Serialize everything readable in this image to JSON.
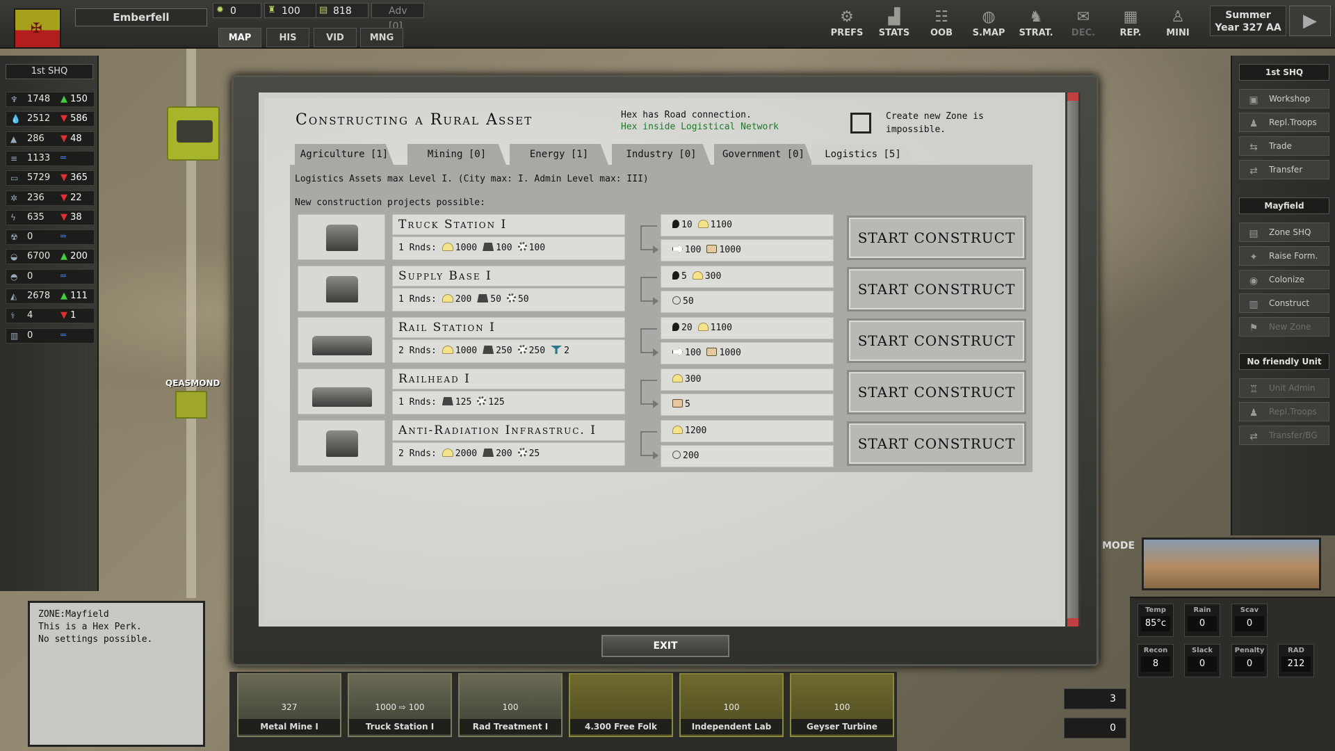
{
  "header": {
    "faction_name": "Emberfell",
    "resources": [
      {
        "icon": "sun-icon",
        "value": "0"
      },
      {
        "icon": "troops-icon",
        "value": "100"
      },
      {
        "icon": "money-icon",
        "value": "818"
      },
      {
        "icon": "adv-icon",
        "value": "Adv [0]"
      }
    ],
    "nav_tabs": [
      "MAP",
      "HIS",
      "VID",
      "MNG"
    ],
    "buttons": [
      {
        "label": "PREFS",
        "icon": "gear-icon"
      },
      {
        "label": "STATS",
        "icon": "chart-icon"
      },
      {
        "label": "OOB",
        "icon": "hierarchy-icon"
      },
      {
        "label": "S.MAP",
        "icon": "globe-icon"
      },
      {
        "label": "STRAT.",
        "icon": "strategy-icon"
      },
      {
        "label": "DEC.",
        "icon": "mail-icon"
      },
      {
        "label": "REP.",
        "icon": "report-icon"
      },
      {
        "label": "MINI",
        "icon": "person-icon"
      }
    ],
    "season": "Summer",
    "year": "Year 327 AA"
  },
  "left_panel": {
    "title": "1st SHQ",
    "stats": [
      {
        "icon": "food-icon",
        "value": "1748",
        "delta": "150",
        "trend": "up"
      },
      {
        "icon": "water-icon",
        "value": "2512",
        "delta": "586",
        "trend": "down"
      },
      {
        "icon": "oil-icon",
        "value": "286",
        "delta": "48",
        "trend": "down"
      },
      {
        "icon": "fuel-icon",
        "value": "1133",
        "delta": "",
        "trend": "eq"
      },
      {
        "icon": "metal-icon",
        "value": "5729",
        "delta": "365",
        "trend": "down"
      },
      {
        "icon": "parts-icon",
        "value": "236",
        "delta": "22",
        "trend": "down"
      },
      {
        "icon": "energy-icon",
        "value": "635",
        "delta": "38",
        "trend": "down"
      },
      {
        "icon": "radiation-icon",
        "value": "0",
        "delta": "",
        "trend": "eq"
      },
      {
        "icon": "ore-icon",
        "value": "6700",
        "delta": "200",
        "trend": "up"
      },
      {
        "icon": "rare-icon",
        "value": "0",
        "delta": "",
        "trend": "eq"
      },
      {
        "icon": "industry-icon",
        "value": "2678",
        "delta": "111",
        "trend": "up"
      },
      {
        "icon": "medicine-icon",
        "value": "4",
        "delta": "1",
        "trend": "down"
      },
      {
        "icon": "data-icon",
        "value": "0",
        "delta": "",
        "trend": "eq"
      }
    ]
  },
  "right_panel": {
    "title": "1st SHQ",
    "buttons_top": [
      "Workshop",
      "Repl.Troops",
      "Trade",
      "Transfer"
    ],
    "zone_title": "Mayfield",
    "buttons_zone": [
      "Zone SHQ",
      "Raise Form.",
      "Colonize",
      "Construct",
      "New Zone"
    ],
    "unit_title": "No friendly Unit",
    "buttons_unit": [
      "Unit Admin",
      "Repl.Troops",
      "Transfer/BG"
    ]
  },
  "map": {
    "town_label": "QEASMOND",
    "mode_label": "MODE"
  },
  "zone_info": {
    "line1": "ZONE:Mayfield",
    "line2": "This is a Hex Perk.",
    "line3": "No settings possible."
  },
  "weather": [
    {
      "label": "Temp",
      "value": "85°c"
    },
    {
      "label": "Rain",
      "value": "0"
    },
    {
      "label": "Scav",
      "value": "0"
    },
    {
      "label": "Recon",
      "value": "8"
    },
    {
      "label": "Slack",
      "value": "0"
    },
    {
      "label": "Penalty",
      "value": "0"
    },
    {
      "label": "RAD",
      "value": "212"
    }
  ],
  "side_counters": [
    "3",
    "0"
  ],
  "bottom_cards": [
    {
      "label": "Metal Mine I",
      "value": "327"
    },
    {
      "label": "Truck Station I",
      "value": "1000 ⇨ 100"
    },
    {
      "label": "Rad Treatment I",
      "value": "100"
    },
    {
      "label": "4.300 Free Folk",
      "value": ""
    },
    {
      "label": "Independent Lab",
      "value": "100"
    },
    {
      "label": "Geyser Turbine",
      "value": "100"
    }
  ],
  "dialog": {
    "title": "Constructing a Rural Asset",
    "road_connection": "Hex has Road connection.",
    "logistics_network": "Hex inside Logistical Network",
    "zone_create": "Create new Zone is impossible.",
    "tabs": [
      "Agriculture [1]",
      "Mining [0]",
      "Energy [1]",
      "Industry [0]",
      "Government [0]",
      "Logistics [5]"
    ],
    "active_tab": "Logistics [5]",
    "max_level_text": "Logistics Assets max Level I. (City max: I. Admin Level max: III)",
    "projects_text": "New construction projects possible:",
    "start_label": "START CONSTRUCT",
    "exit_label": "EXIT",
    "projects": [
      {
        "name": "Truck Station I",
        "rounds": "1 Rnds:",
        "build_costs": [
          [
            "c-i",
            "1000"
          ],
          [
            "c-g",
            "100"
          ],
          [
            "c-s",
            "100"
          ]
        ],
        "upkeep": [
          [
            "c-w",
            "10"
          ],
          [
            "c-i",
            "1100"
          ]
        ],
        "output": [
          [
            "c-a",
            "100"
          ],
          [
            "c-t",
            "1000"
          ]
        ]
      },
      {
        "name": "Supply Base I",
        "rounds": "1 Rnds:",
        "build_costs": [
          [
            "c-i",
            "200"
          ],
          [
            "c-g",
            "50"
          ],
          [
            "c-s",
            "50"
          ]
        ],
        "upkeep": [
          [
            "c-w",
            "5"
          ],
          [
            "c-i",
            "300"
          ]
        ],
        "output": [
          [
            "c-h",
            "50"
          ]
        ]
      },
      {
        "name": "Rail Station I",
        "rounds": "2 Rnds:",
        "build_costs": [
          [
            "c-i",
            "1000"
          ],
          [
            "c-g",
            "250"
          ],
          [
            "c-s",
            "250"
          ],
          [
            "c-p",
            "2"
          ]
        ],
        "upkeep": [
          [
            "c-w",
            "20"
          ],
          [
            "c-i",
            "1100"
          ]
        ],
        "output": [
          [
            "c-a",
            "100"
          ],
          [
            "c-t",
            "1000"
          ]
        ]
      },
      {
        "name": "Railhead I",
        "rounds": "1 Rnds:",
        "build_costs": [
          [
            "c-g",
            "125"
          ],
          [
            "c-s",
            "125"
          ]
        ],
        "upkeep": [
          [
            "c-i",
            "300"
          ]
        ],
        "output": [
          [
            "c-t",
            "5"
          ]
        ]
      },
      {
        "name": "Anti-Radiation Infrastruc. I",
        "rounds": "2 Rnds:",
        "build_costs": [
          [
            "c-i",
            "2000"
          ],
          [
            "c-g",
            "200"
          ],
          [
            "c-s",
            "25"
          ]
        ],
        "upkeep": [
          [
            "c-i",
            "1200"
          ]
        ],
        "output": [
          [
            "c-h",
            "200"
          ]
        ]
      }
    ]
  }
}
